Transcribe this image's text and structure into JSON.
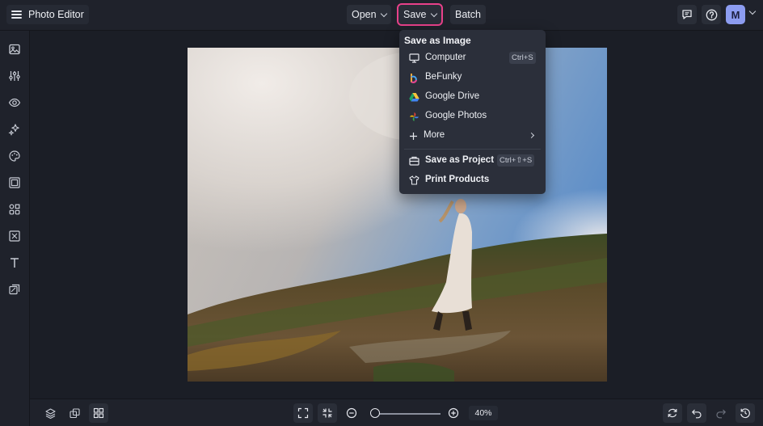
{
  "header": {
    "app_title": "Photo Editor",
    "open_label": "Open",
    "save_label": "Save",
    "batch_label": "Batch",
    "avatar_initial": "M"
  },
  "save_menu": {
    "title": "Save as Image",
    "items": [
      {
        "label": "Computer",
        "shortcut": "Ctrl+S",
        "icon": "monitor-icon"
      },
      {
        "label": "BeFunky",
        "icon": "befunky-logo-icon"
      },
      {
        "label": "Google Drive",
        "icon": "google-drive-icon"
      },
      {
        "label": "Google Photos",
        "icon": "google-photos-icon"
      },
      {
        "label": "More",
        "icon": "plus-icon"
      },
      {
        "label": "Save as Project",
        "shortcut": "Ctrl+⇧+S",
        "icon": "project-icon"
      },
      {
        "label": "Print Products",
        "icon": "shirt-icon"
      }
    ]
  },
  "sidebar": {
    "items": [
      "image-icon",
      "sliders-icon",
      "eye-icon",
      "sparkle-icon",
      "palette-icon",
      "frame-icon",
      "graphics-icon",
      "texture-icon",
      "text-icon",
      "layers-stack-icon"
    ]
  },
  "bottom": {
    "zoom_value": "40%",
    "zoom_level": 0.1
  },
  "colors": {
    "accent": "#e8418a",
    "avatar": "#8c9cf0",
    "background": "#1b1e26"
  }
}
